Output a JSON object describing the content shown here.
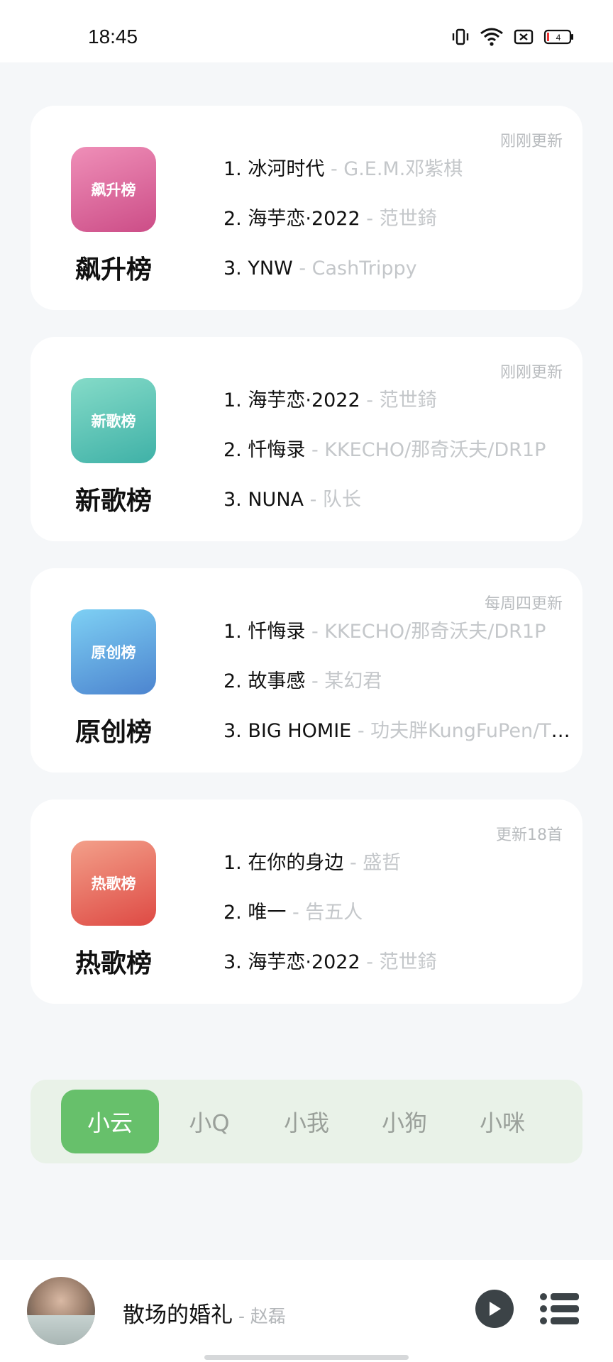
{
  "status_bar": {
    "time": "18:45",
    "battery_level": "4",
    "icons": [
      "vibrate-icon",
      "wifi-icon",
      "sim-off-icon",
      "battery-icon"
    ]
  },
  "charts": [
    {
      "cover_label": "飙升榜",
      "name": "飙升榜",
      "update": "刚刚更新",
      "songs": [
        {
          "index": "1.",
          "title": "冰河时代",
          "artist": " - G.E.M.邓紫棋"
        },
        {
          "index": "2.",
          "title": "海芋恋·2022",
          "artist": " - 范世錡"
        },
        {
          "index": "3.",
          "title": "YNW",
          "artist": " - CashTrippy"
        }
      ]
    },
    {
      "cover_label": "新歌榜",
      "name": "新歌榜",
      "update": "刚刚更新",
      "songs": [
        {
          "index": "1.",
          "title": "海芋恋·2022",
          "artist": " - 范世錡"
        },
        {
          "index": "2.",
          "title": "忏悔录",
          "artist": " - KKECHO/那奇沃夫/DR1P"
        },
        {
          "index": "3.",
          "title": "NUNA",
          "artist": " - 队长"
        }
      ]
    },
    {
      "cover_label": "原创榜",
      "name": "原创榜",
      "update": "每周四更新",
      "songs": [
        {
          "index": "1.",
          "title": "忏悔录",
          "artist": " - KKECHO/那奇沃夫/DR1P"
        },
        {
          "index": "2.",
          "title": "故事感",
          "artist": " - 某幻君"
        },
        {
          "index": "3.",
          "title": "BIG HOMIE",
          "artist": " - 功夫胖KungFuPen/Th..."
        }
      ]
    },
    {
      "cover_label": "热歌榜",
      "name": "热歌榜",
      "update": "更新18首",
      "songs": [
        {
          "index": "1.",
          "title": "在你的身边",
          "artist": " - 盛哲"
        },
        {
          "index": "2.",
          "title": "唯一",
          "artist": " - 告五人"
        },
        {
          "index": "3.",
          "title": "海芋恋·2022",
          "artist": " - 范世錡"
        }
      ]
    }
  ],
  "tabs": [
    {
      "label": "小云",
      "active": true
    },
    {
      "label": "小Q",
      "active": false
    },
    {
      "label": "小我",
      "active": false
    },
    {
      "label": "小狗",
      "active": false
    },
    {
      "label": "小咪",
      "active": false
    }
  ],
  "colors": {
    "accent_green": "#67c06b",
    "tab_bar_bg": "#e9f2e8",
    "artist_grey": "#c4c7ca"
  },
  "player": {
    "song_title": "散场的婚礼",
    "artist": " - 赵磊",
    "play_icon": "play-icon",
    "playlist_icon": "playlist-icon"
  }
}
